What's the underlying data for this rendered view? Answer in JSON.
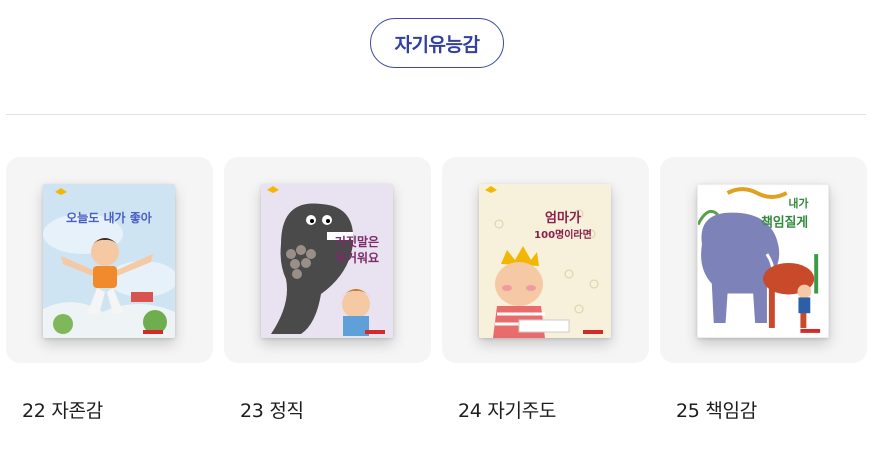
{
  "category": {
    "label": "자기유능감"
  },
  "books": [
    {
      "number": "22",
      "theme": "자존감",
      "cover_title": "오늘도 내가 좋아",
      "cover_colors": {
        "bg": "#cfe4f3",
        "accent": "#4a5fc4"
      }
    },
    {
      "number": "23",
      "theme": "정직",
      "cover_title_lines": [
        "거짓말은",
        "무거워요"
      ],
      "cover_colors": {
        "bg": "#e9e2f0",
        "accent": "#7b2a6a"
      }
    },
    {
      "number": "24",
      "theme": "자기주도",
      "cover_title_lines": [
        "엄마가",
        "100명이라면"
      ],
      "cover_colors": {
        "bg": "#f7f1dc",
        "accent": "#8b1e4a"
      }
    },
    {
      "number": "25",
      "theme": "책임감",
      "cover_title_lines": [
        "내가",
        "책임질게"
      ],
      "cover_colors": {
        "bg": "#ffffff",
        "accent": "#2f8a3a"
      }
    }
  ]
}
